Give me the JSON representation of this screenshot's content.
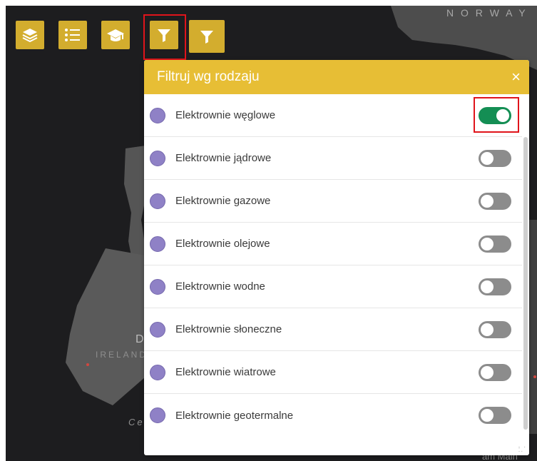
{
  "map": {
    "labels": {
      "norway": "N O R W A Y",
      "ireland": "IRELAND",
      "ireland_d": "D",
      "celtic": "Ce",
      "main": "am Main"
    }
  },
  "toolbar": {
    "buttons": [
      {
        "icon": "layers-icon",
        "active": false
      },
      {
        "icon": "list-icon",
        "active": false
      },
      {
        "icon": "graduation-cap-icon",
        "active": false
      },
      {
        "icon": "filter-icon",
        "active": true
      },
      {
        "icon": "filter-icon",
        "active": false
      }
    ]
  },
  "panel": {
    "title": "Filtruj wg rodzaju",
    "close": "×",
    "items": [
      {
        "label": "Elektrownie węglowe",
        "enabled": true
      },
      {
        "label": "Elektrownie jądrowe",
        "enabled": false
      },
      {
        "label": "Elektrownie gazowe",
        "enabled": false
      },
      {
        "label": "Elektrownie olejowe",
        "enabled": false
      },
      {
        "label": "Elektrownie wodne",
        "enabled": false
      },
      {
        "label": "Elektrownie słoneczne",
        "enabled": false
      },
      {
        "label": "Elektrownie wiatrowe",
        "enabled": false
      },
      {
        "label": "Elektrownie geotermalne",
        "enabled": false
      }
    ]
  },
  "colors": {
    "map_bg": "#1d1d1f",
    "land": "#555555",
    "toolbar_button": "#d3ad2e",
    "panel_header": "#e7be35",
    "dot": "#8f81c6",
    "toggle_on": "#148e54",
    "toggle_off": "#8c8c8c",
    "highlight": "#e0141b"
  }
}
